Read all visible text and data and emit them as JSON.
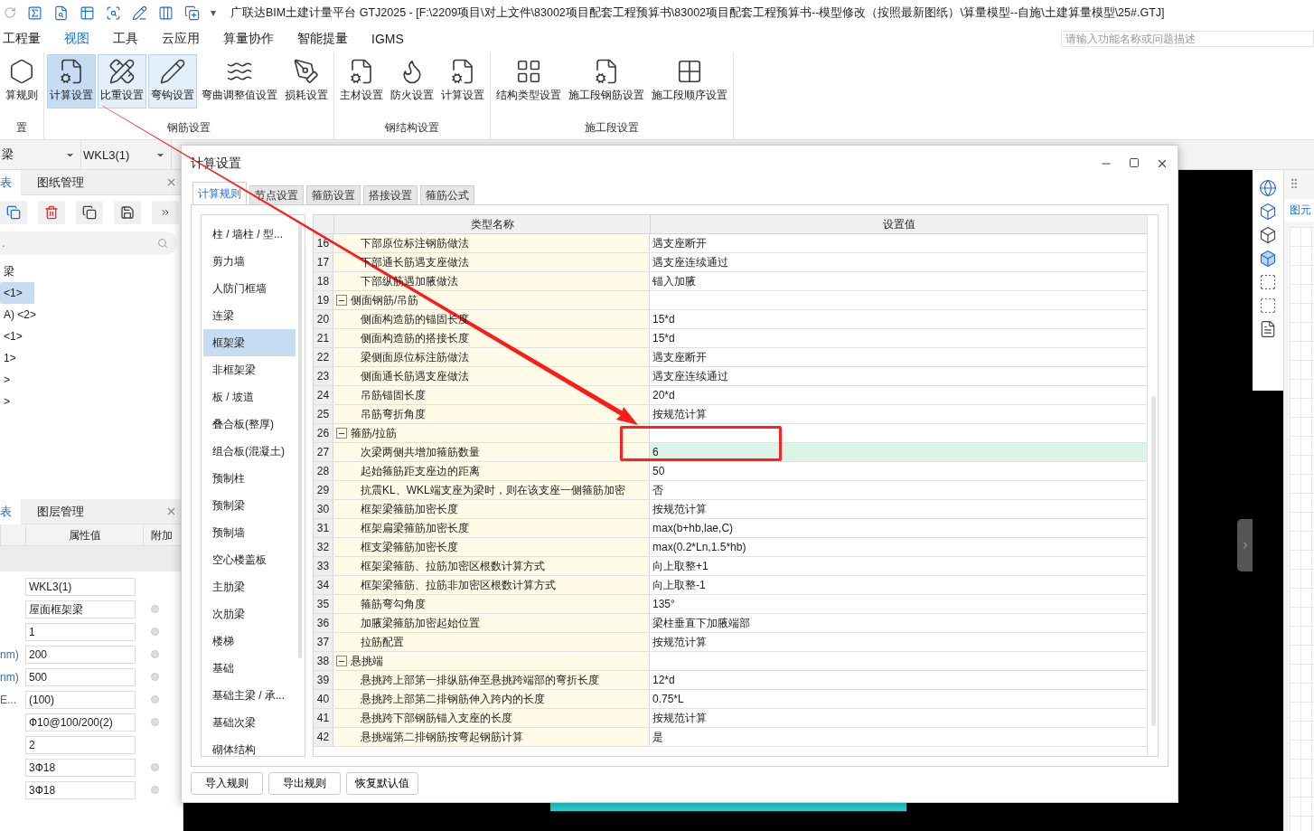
{
  "window": {
    "title": "广联达BIM土建计量平台 GTJ2025 - [F:\\2209项目\\对上文件\\83002项目配套工程预算书\\83002项目配套工程预算书--模型修改（按照最新图纸）\\算量模型--自施\\土建算量模型\\25#.GTJ]",
    "quick_access_more": "▾"
  },
  "menu": [
    {
      "label": "工程量",
      "selected": false
    },
    {
      "label": "视图",
      "selected": true
    },
    {
      "label": "工具",
      "selected": false
    },
    {
      "label": "云应用",
      "selected": false
    },
    {
      "label": "算量协作",
      "selected": false
    },
    {
      "label": "智能提量",
      "selected": false
    },
    {
      "label": "IGMS",
      "selected": false
    }
  ],
  "search": {
    "placeholder": "请输入功能名称或问题描述"
  },
  "ribbon": [
    {
      "label": "置",
      "buttons": [
        {
          "label": "算规则",
          "selected": false,
          "on": false
        }
      ]
    },
    {
      "label": "钢筋设置",
      "buttons": [
        {
          "label": "计算设置",
          "selected": true,
          "on": true
        },
        {
          "label": "比重设置",
          "selected": false,
          "on": true
        },
        {
          "label": "弯钩设置",
          "selected": false,
          "on": true
        },
        {
          "label": "弯曲调整值设置",
          "selected": false,
          "on": false
        },
        {
          "label": "损耗设置",
          "selected": false,
          "on": false
        }
      ]
    },
    {
      "label": "钢结构设置",
      "buttons": [
        {
          "label": "主材设置",
          "selected": false,
          "on": false
        },
        {
          "label": "防火设置",
          "selected": false,
          "on": false
        },
        {
          "label": "计算设置",
          "selected": false,
          "on": false
        }
      ]
    },
    {
      "label": "施工段设置",
      "buttons": [
        {
          "label": "结构类型设置",
          "selected": false,
          "on": false
        },
        {
          "label": "施工段钢筋设置",
          "selected": false,
          "on": false
        },
        {
          "label": "施工段顺序设置",
          "selected": false,
          "on": false
        }
      ]
    }
  ],
  "selectors": [
    {
      "value": "梁"
    },
    {
      "value": "WKL3(1)"
    }
  ],
  "left_panel": {
    "tabs": [
      {
        "label": "表",
        "selected": true
      },
      {
        "label": "图纸管理",
        "selected": false
      }
    ],
    "search": {
      "placeholder": "."
    },
    "tree": [
      {
        "label": "梁",
        "selected": false
      },
      {
        "label": "<1>",
        "selected": true
      },
      {
        "label": "A) <2>",
        "selected": false
      },
      {
        "label": "<1>",
        "selected": false
      },
      {
        "label": "1>",
        "selected": false
      },
      {
        "label": ">",
        "selected": false
      },
      {
        "label": ">",
        "selected": false
      }
    ]
  },
  "properties_panel": {
    "tabs": [
      {
        "label": "表",
        "selected": true
      },
      {
        "label": "图层管理",
        "selected": false
      }
    ],
    "columns": [
      {
        "label": "属性值"
      },
      {
        "label": "附加"
      }
    ],
    "rows": [
      {
        "value": "WKL3(1)",
        "attachable": false
      },
      {
        "value": "屋面框架梁",
        "attachable": true
      },
      {
        "value": "1",
        "attachable": true
      },
      {
        "label": "nm)",
        "value": "200",
        "attachable": true
      },
      {
        "label": "nm)",
        "value": "500",
        "attachable": true
      },
      {
        "label": "E...",
        "value": "(100)",
        "attachable": true
      },
      {
        "value": "Ф10@100/200(2)",
        "attachable": true
      },
      {
        "value": "2",
        "attachable": false
      },
      {
        "value": "3Ф18",
        "attachable": true
      },
      {
        "value": "3Ф18",
        "attachable": true
      }
    ]
  },
  "right_panel": {
    "tab": "图元"
  },
  "dialog": {
    "title": "计算设置",
    "tabs": [
      {
        "label": "计算规则",
        "selected": true
      },
      {
        "label": "节点设置",
        "selected": false
      },
      {
        "label": "箍筋设置",
        "selected": false
      },
      {
        "label": "搭接设置",
        "selected": false
      },
      {
        "label": "箍筋公式",
        "selected": false
      }
    ],
    "categories": [
      {
        "label": "柱 / 墙柱 / 型...",
        "selected": false
      },
      {
        "label": "剪力墙",
        "selected": false
      },
      {
        "label": "人防门框墙",
        "selected": false
      },
      {
        "label": "连梁",
        "selected": false
      },
      {
        "label": "框架梁",
        "selected": true
      },
      {
        "label": "非框架梁",
        "selected": false
      },
      {
        "label": "板 / 坡道",
        "selected": false
      },
      {
        "label": "叠合板(整厚)",
        "selected": false
      },
      {
        "label": "组合板(混凝土)",
        "selected": false
      },
      {
        "label": "预制柱",
        "selected": false
      },
      {
        "label": "预制梁",
        "selected": false
      },
      {
        "label": "预制墙",
        "selected": false
      },
      {
        "label": "空心楼盖板",
        "selected": false
      },
      {
        "label": "主肋梁",
        "selected": false
      },
      {
        "label": "次肋梁",
        "selected": false
      },
      {
        "label": "楼梯",
        "selected": false
      },
      {
        "label": "基础",
        "selected": false
      },
      {
        "label": "基础主梁 / 承...",
        "selected": false
      },
      {
        "label": "基础次梁",
        "selected": false
      },
      {
        "label": "砌体结构",
        "selected": false
      }
    ],
    "table": {
      "columns": [
        {
          "label": "类型名称"
        },
        {
          "label": "设置值"
        }
      ],
      "rows": [
        {
          "kind": "item",
          "number": "16",
          "name": "下部原位标注钢筋做法",
          "value": "遇支座断开",
          "selected": false
        },
        {
          "kind": "item",
          "number": "17",
          "name": "下部通长筋遇支座做法",
          "value": "遇支座连续通过",
          "selected": false
        },
        {
          "kind": "item",
          "number": "18",
          "name": "下部纵筋遇加腋做法",
          "value": "锚入加腋",
          "selected": false
        },
        {
          "kind": "group",
          "number": "19",
          "name": "侧面钢筋/吊筋",
          "expanded": true,
          "selected": false
        },
        {
          "kind": "item",
          "number": "20",
          "name": "侧面构造筋的锚固长度",
          "value": "15*d",
          "selected": false
        },
        {
          "kind": "item",
          "number": "21",
          "name": "侧面构造筋的搭接长度",
          "value": "15*d",
          "selected": false
        },
        {
          "kind": "item",
          "number": "22",
          "name": "梁侧面原位标注筋做法",
          "value": "遇支座断开",
          "selected": false
        },
        {
          "kind": "item",
          "number": "23",
          "name": "侧面通长筋遇支座做法",
          "value": "遇支座连续通过",
          "selected": false
        },
        {
          "kind": "item",
          "number": "24",
          "name": "吊筋锚固长度",
          "value": "20*d",
          "selected": false
        },
        {
          "kind": "item",
          "number": "25",
          "name": "吊筋弯折角度",
          "value": "按规范计算",
          "selected": false
        },
        {
          "kind": "group",
          "number": "26",
          "name": "箍筋/拉筋",
          "expanded": true,
          "selected": false
        },
        {
          "kind": "item",
          "number": "27",
          "name": "次梁两侧共增加箍筋数量",
          "value": "6",
          "selected": true
        },
        {
          "kind": "item",
          "number": "28",
          "name": "起始箍筋距支座边的距离",
          "value": "50",
          "selected": false
        },
        {
          "kind": "item",
          "number": "29",
          "name": "抗震KL、WKL端支座为梁时，则在该支座一侧箍筋加密",
          "value": "否",
          "selected": false
        },
        {
          "kind": "item",
          "number": "30",
          "name": "框架梁箍筋加密长度",
          "value": "按规范计算",
          "selected": false
        },
        {
          "kind": "item",
          "number": "31",
          "name": "框架扁梁箍筋加密长度",
          "value": "max(b+hb,lae,C)",
          "selected": false
        },
        {
          "kind": "item",
          "number": "32",
          "name": "框支梁箍筋加密长度",
          "value": "max(0.2*Ln,1.5*hb)",
          "selected": false
        },
        {
          "kind": "item",
          "number": "33",
          "name": "框架梁箍筋、拉筋加密区根数计算方式",
          "value": "向上取整+1",
          "selected": false
        },
        {
          "kind": "item",
          "number": "34",
          "name": "框架梁箍筋、拉筋非加密区根数计算方式",
          "value": "向上取整-1",
          "selected": false
        },
        {
          "kind": "item",
          "number": "35",
          "name": "箍筋弯勾角度",
          "value": "135°",
          "selected": false
        },
        {
          "kind": "item",
          "number": "36",
          "name": "加腋梁箍筋加密起始位置",
          "value": "梁柱垂直下加腋端部",
          "selected": false
        },
        {
          "kind": "item",
          "number": "37",
          "name": "拉筋配置",
          "value": "按规范计算",
          "selected": false
        },
        {
          "kind": "group",
          "number": "38",
          "name": "悬挑端",
          "expanded": true,
          "selected": false
        },
        {
          "kind": "item",
          "number": "39",
          "name": "悬挑跨上部第一排纵筋伸至悬挑跨端部的弯折长度",
          "value": "12*d",
          "selected": false
        },
        {
          "kind": "item",
          "number": "40",
          "name": "悬挑跨上部第二排钢筋伸入跨内的长度",
          "value": "0.75*L",
          "selected": false
        },
        {
          "kind": "item",
          "number": "41",
          "name": "悬挑跨下部钢筋锚入支座的长度",
          "value": "按规范计算",
          "selected": false
        },
        {
          "kind": "item",
          "number": "42",
          "name": "悬挑端第二排钢筋按弯起钢筋计算",
          "value": "是",
          "selected": false
        }
      ]
    },
    "buttons": [
      {
        "label": "导入规则"
      },
      {
        "label": "导出规则"
      },
      {
        "label": "恢复默认值"
      }
    ]
  }
}
